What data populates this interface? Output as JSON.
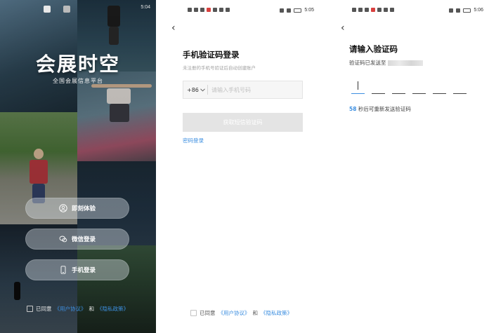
{
  "panel1": {
    "status_time": "5:04",
    "brand_title": "会展时空",
    "brand_subtitle": "全国会展信息平台",
    "buttons": [
      {
        "label": "即刻体验",
        "icon": "user-icon"
      },
      {
        "label": "微信登录",
        "icon": "wechat-icon"
      },
      {
        "label": "手机登录",
        "icon": "phone-icon"
      }
    ],
    "agree": {
      "prefix": "已同意",
      "user_agreement": "《用户协议》",
      "and": "和",
      "privacy_policy": "《隐私政策》"
    }
  },
  "panel2": {
    "status_time": "5:05",
    "title": "手机验证码登录",
    "hint": "未注册的手机号验证后自动创建账户",
    "country_code": "+86",
    "phone_placeholder": "请输入手机号码",
    "get_code_label": "获取短信验证码",
    "password_login_label": "密码登录",
    "agree": {
      "prefix": "已同意",
      "user_agreement": "《用户协议》",
      "and": "和",
      "privacy_policy": "《隐私政策》"
    }
  },
  "panel3": {
    "status_time": "5:06",
    "title": "请输入验证码",
    "sent_text": "验证码已发送至",
    "countdown_seconds": "58",
    "resend_text": "秒后可重新发送验证码",
    "code_length": 6
  },
  "colors": {
    "link": "#3d8fe0",
    "button_disabled": "#e4e4e4",
    "pill_bg": "rgba(214,222,228,0.42)"
  }
}
